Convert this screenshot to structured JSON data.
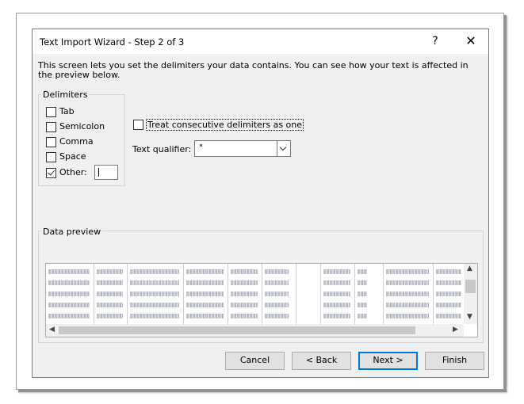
{
  "dialog": {
    "title": "Text Import Wizard - Step 2 of 3",
    "help_glyph": "?",
    "close_glyph": "✕",
    "description": "This screen lets you set the delimiters your data contains.  You can see how your text is affected in the preview below."
  },
  "delimiters": {
    "group_label": "Delimiters",
    "items": [
      {
        "label": "Tab",
        "checked": false
      },
      {
        "label": "Semicolon",
        "checked": false
      },
      {
        "label": "Comma",
        "checked": false
      },
      {
        "label": "Space",
        "checked": false
      },
      {
        "label": "Other:",
        "checked": true
      }
    ],
    "other_value": ""
  },
  "options": {
    "consecutive_label": "Treat consecutive delimiters as one",
    "consecutive_checked": false,
    "qualifier_label": "Text qualifier:",
    "qualifier_value": "\""
  },
  "preview": {
    "group_label": "Data preview"
  },
  "buttons": {
    "cancel": "Cancel",
    "back": "< Back",
    "next": "Next >",
    "finish": "Finish"
  },
  "colors": {
    "default_button_border": "#0078d7",
    "dialog_bg": "#f0f0f0"
  }
}
